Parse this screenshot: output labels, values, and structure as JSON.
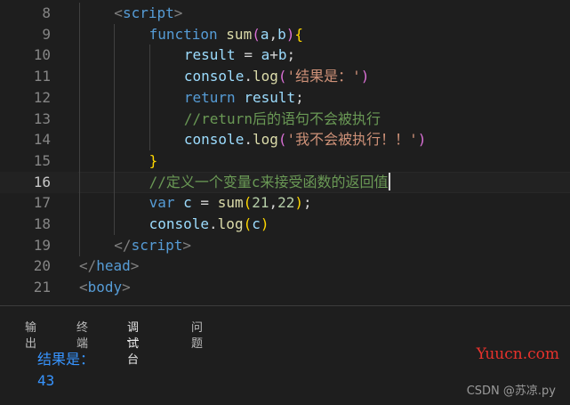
{
  "editor": {
    "current_line": "16",
    "lines": [
      {
        "n": "8",
        "tokens": [
          [
            "<",
            "t-punct"
          ],
          [
            "script",
            "t-tag"
          ],
          [
            ">",
            "t-punct"
          ]
        ]
      },
      {
        "n": "9",
        "tokens": [
          [
            "function",
            "t-kw"
          ],
          [
            " ",
            "t-plain"
          ],
          [
            "sum",
            "t-fn"
          ],
          [
            "(",
            "t-paren"
          ],
          [
            "a",
            "t-var"
          ],
          [
            ",",
            "t-plain"
          ],
          [
            "b",
            "t-var"
          ],
          [
            ")",
            "t-paren"
          ],
          [
            "{",
            "t-brace"
          ]
        ]
      },
      {
        "n": "10",
        "tokens": [
          [
            "result",
            "t-var"
          ],
          [
            " = ",
            "t-plain"
          ],
          [
            "a",
            "t-var"
          ],
          [
            "+",
            "t-plain"
          ],
          [
            "b",
            "t-var"
          ],
          [
            ";",
            "t-plain"
          ]
        ]
      },
      {
        "n": "11",
        "tokens": [
          [
            "console",
            "t-var"
          ],
          [
            ".",
            "t-plain"
          ],
          [
            "log",
            "t-fn"
          ],
          [
            "(",
            "t-paren"
          ],
          [
            "'结果是：'",
            "t-str"
          ],
          [
            ")",
            "t-paren"
          ]
        ]
      },
      {
        "n": "12",
        "tokens": [
          [
            "return",
            "t-kw"
          ],
          [
            " ",
            "t-plain"
          ],
          [
            "result",
            "t-var"
          ],
          [
            ";",
            "t-plain"
          ]
        ]
      },
      {
        "n": "13",
        "tokens": [
          [
            "//return后的语句不会被执行",
            "t-com"
          ]
        ]
      },
      {
        "n": "14",
        "tokens": [
          [
            "console",
            "t-var"
          ],
          [
            ".",
            "t-plain"
          ],
          [
            "log",
            "t-fn"
          ],
          [
            "(",
            "t-paren"
          ],
          [
            "'我不会被执行！！'",
            "t-str"
          ],
          [
            ")",
            "t-paren"
          ]
        ]
      },
      {
        "n": "15",
        "tokens": [
          [
            "}",
            "t-brace"
          ]
        ]
      },
      {
        "n": "16",
        "tokens": [
          [
            "//定义一个变量c来接受函数的返回值",
            "t-com"
          ]
        ],
        "cursor": true
      },
      {
        "n": "17",
        "tokens": [
          [
            "var",
            "t-kw"
          ],
          [
            " ",
            "t-plain"
          ],
          [
            "c",
            "t-var"
          ],
          [
            " = ",
            "t-plain"
          ],
          [
            "sum",
            "t-fn"
          ],
          [
            "(",
            "t-brace"
          ],
          [
            "21",
            "t-num"
          ],
          [
            ",",
            "t-plain"
          ],
          [
            "22",
            "t-num"
          ],
          [
            ")",
            "t-brace"
          ],
          [
            ";",
            "t-plain"
          ]
        ]
      },
      {
        "n": "18",
        "tokens": [
          [
            "console",
            "t-var"
          ],
          [
            ".",
            "t-plain"
          ],
          [
            "log",
            "t-fn"
          ],
          [
            "(",
            "t-brace"
          ],
          [
            "c",
            "t-var"
          ],
          [
            ")",
            "t-brace"
          ]
        ]
      },
      {
        "n": "19",
        "tokens": [
          [
            "</",
            "t-punct"
          ],
          [
            "script",
            "t-tag"
          ],
          [
            ">",
            "t-punct"
          ]
        ]
      },
      {
        "n": "20",
        "tokens": [
          [
            "</",
            "t-punct"
          ],
          [
            "head",
            "t-tag"
          ],
          [
            ">",
            "t-punct"
          ]
        ]
      },
      {
        "n": "21",
        "tokens": [
          [
            "<",
            "t-punct"
          ],
          [
            "body",
            "t-tag"
          ],
          [
            ">",
            "t-punct"
          ]
        ]
      }
    ]
  },
  "panel": {
    "tabs": [
      "输出",
      "终端",
      "调试台",
      "问题"
    ],
    "active_tab": "调试台",
    "output": [
      "结果是：",
      "43"
    ]
  },
  "watermark": {
    "site": "Yuucn.com",
    "author": "CSDN @苏凉.py"
  },
  "colors": {
    "background": "#1e1e1e",
    "output_text": "#3794ff",
    "watermark_red": "#e8322c"
  }
}
